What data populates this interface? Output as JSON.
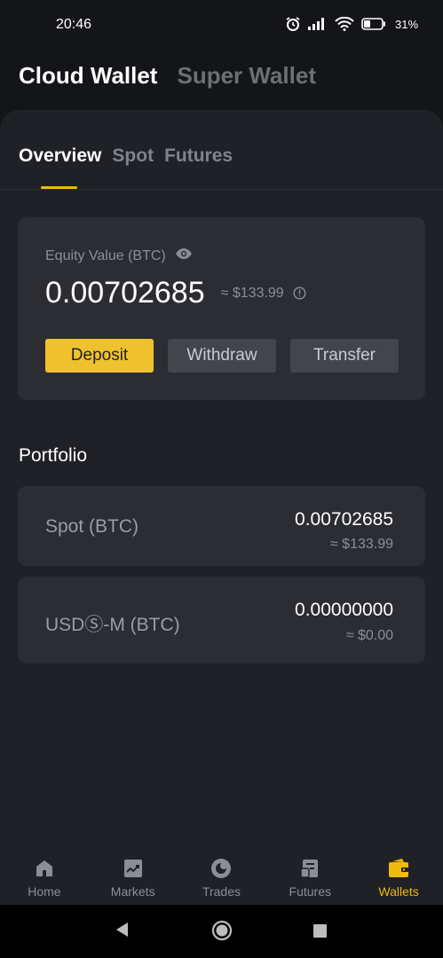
{
  "status_bar": {
    "time": "20:46",
    "battery": "31"
  },
  "top_tabs": [
    {
      "label": "Cloud Wallet",
      "active": true
    },
    {
      "label": "Super Wallet",
      "active": false
    }
  ],
  "sub_tabs": [
    {
      "label": "Overview",
      "active": true
    },
    {
      "label": "Spot",
      "active": false
    },
    {
      "label": "Futures",
      "active": false
    }
  ],
  "equity": {
    "label": "Equity Value (BTC)",
    "value": "0.00702685",
    "approx": "≈ $133.99",
    "buttons": {
      "deposit": "Deposit",
      "withdraw": "Withdraw",
      "transfer": "Transfer"
    }
  },
  "portfolio": {
    "title": "Portfolio",
    "items": [
      {
        "name": "Spot (BTC)",
        "value": "0.00702685",
        "approx": "≈ $133.99"
      },
      {
        "name": "USDⓈ-M (BTC)",
        "value": "0.00000000",
        "approx": "≈ $0.00"
      }
    ]
  },
  "bottom_nav": [
    {
      "label": "Home",
      "icon": "home-icon"
    },
    {
      "label": "Markets",
      "icon": "markets-icon"
    },
    {
      "label": "Trades",
      "icon": "trades-icon"
    },
    {
      "label": "Futures",
      "icon": "futures-icon"
    },
    {
      "label": "Wallets",
      "icon": "wallet-icon",
      "active": true
    }
  ],
  "colors": {
    "accent": "#f0b90b",
    "background": "#141518",
    "card": "#2b2d33"
  }
}
